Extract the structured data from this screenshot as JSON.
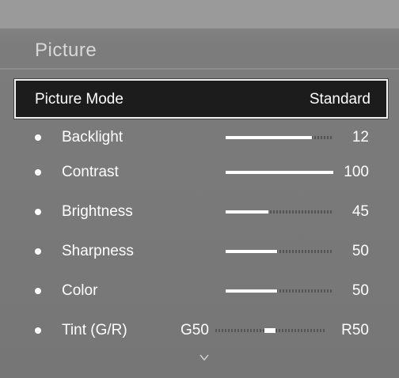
{
  "menu": {
    "title": "Picture",
    "picture_mode": {
      "label": "Picture Mode",
      "value": "Standard"
    },
    "items": [
      {
        "label": "Backlight",
        "value": "12",
        "level": 0.8
      },
      {
        "label": "Contrast",
        "value": "100",
        "level": 1.0
      },
      {
        "label": "Brightness",
        "value": "45",
        "level": 0.4
      },
      {
        "label": "Sharpness",
        "value": "50",
        "level": 0.48
      },
      {
        "label": "Color",
        "value": "50",
        "level": 0.48
      }
    ],
    "tint": {
      "label": "Tint (G/R)",
      "green": "G50",
      "red": "R50",
      "balance": 0.5
    },
    "more_icon": "chevron-down-icon"
  }
}
